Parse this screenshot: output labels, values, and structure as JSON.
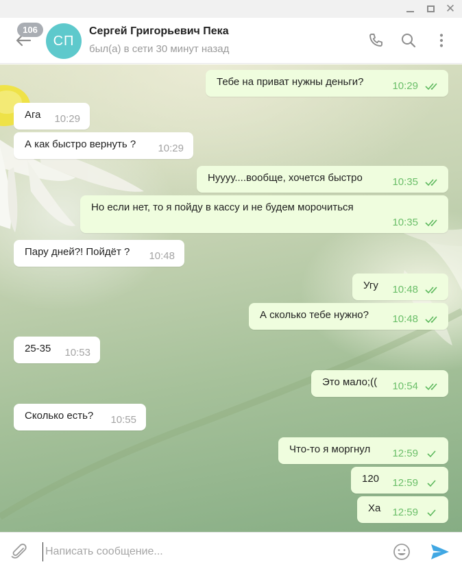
{
  "window": {
    "minimize_icon": "minimize-icon",
    "maximize_icon": "maximize-icon",
    "close_icon": "close-icon"
  },
  "header": {
    "unread_count": "106",
    "avatar_initials": "СП",
    "avatar_color": "#5ec9cc",
    "contact_name": "Сергей Григорьевич Пека",
    "status": "был(а) в сети 30 минут назад",
    "icons": [
      "back-arrow-icon",
      "phone-icon",
      "search-icon",
      "more-vertical-icon"
    ]
  },
  "messages": [
    {
      "direction": "out",
      "text": "Тебе на приват нужны деньги?",
      "time": "10:29",
      "status": "read"
    },
    {
      "direction": "in",
      "text": "Ага",
      "time": "10:29"
    },
    {
      "direction": "in",
      "text": "А как быстро вернуть ?",
      "time": "10:29"
    },
    {
      "direction": "out",
      "text": "Нуууу....вообще, хочется быстро",
      "time": "10:35",
      "status": "read"
    },
    {
      "direction": "out",
      "text": "Но если нет, то я пойду в кассу и не будем морочиться",
      "time": "10:35",
      "status": "read"
    },
    {
      "direction": "in",
      "text": "Пару дней?! Пойдёт ?",
      "time": "10:48"
    },
    {
      "direction": "out",
      "text": "Угу",
      "time": "10:48",
      "status": "read"
    },
    {
      "direction": "out",
      "text": "А сколько тебе нужно?",
      "time": "10:48",
      "status": "read"
    },
    {
      "direction": "in",
      "text": "25-35",
      "time": "10:53"
    },
    {
      "direction": "out",
      "text": "Это мало;((",
      "time": "10:54",
      "status": "read"
    },
    {
      "direction": "in",
      "text": "Сколько есть?",
      "time": "10:55"
    },
    {
      "direction": "out",
      "text": "Что-то я моргнул",
      "time": "12:59",
      "status": "sent"
    },
    {
      "direction": "out",
      "text": "120",
      "time": "12:59",
      "status": "sent"
    },
    {
      "direction": "out",
      "text": "Ха",
      "time": "12:59",
      "status": "sent"
    }
  ],
  "composer": {
    "placeholder": "Написать сообщение...",
    "icons": [
      "paperclip-icon",
      "emoji-icon",
      "send-icon"
    ]
  },
  "colors": {
    "incoming_bubble": "#ffffff",
    "outgoing_bubble": "#effdde",
    "tick_color": "#5cb85c",
    "accent": "#40a7e3"
  }
}
